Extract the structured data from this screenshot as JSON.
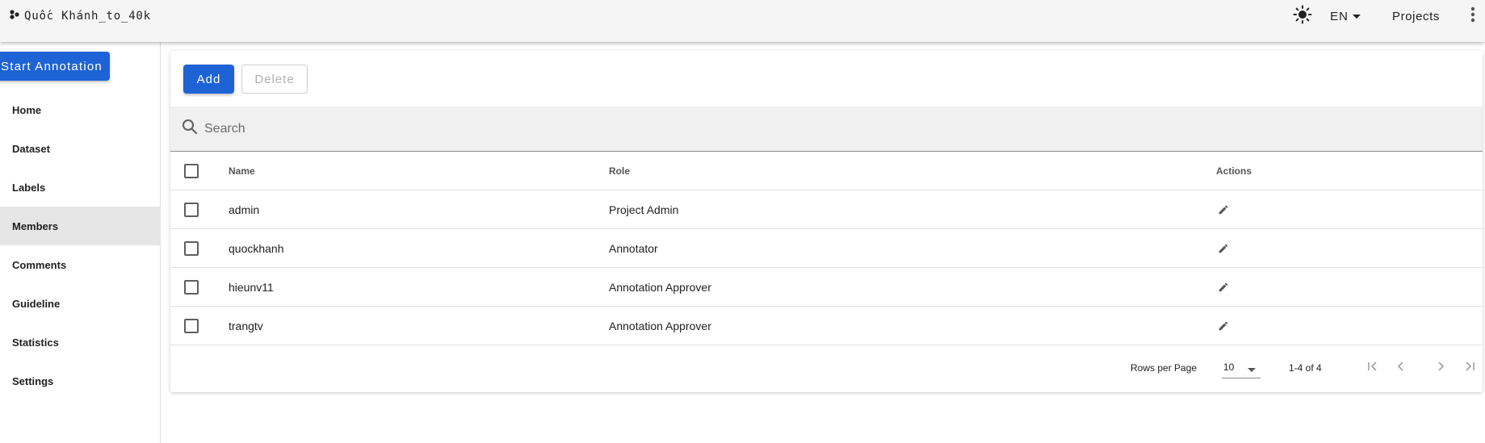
{
  "app": {
    "project_name": "Quốc Khánh_to_40k",
    "language": "EN",
    "projects_label": "Projects",
    "icons": {
      "brand": "hub-icon",
      "theme": "sun-icon",
      "lang_dropdown": "caret-down-icon",
      "more": "more-vert-icon"
    }
  },
  "sidebar": {
    "start_button": "Start Annotation",
    "items": [
      {
        "label": "Home",
        "active": false
      },
      {
        "label": "Dataset",
        "active": false
      },
      {
        "label": "Labels",
        "active": false
      },
      {
        "label": "Members",
        "active": true
      },
      {
        "label": "Comments",
        "active": false
      },
      {
        "label": "Guideline",
        "active": false
      },
      {
        "label": "Statistics",
        "active": false
      },
      {
        "label": "Settings",
        "active": false
      }
    ]
  },
  "toolbar": {
    "add_label": "Add",
    "delete_label": "Delete"
  },
  "search": {
    "placeholder": "Search",
    "value": ""
  },
  "table": {
    "headers": {
      "name": "Name",
      "role": "Role",
      "actions": "Actions"
    },
    "rows": [
      {
        "name": "admin",
        "role": "Project Admin"
      },
      {
        "name": "quockhanh",
        "role": "Annotator"
      },
      {
        "name": "hieunv11",
        "role": "Annotation Approver"
      },
      {
        "name": "trangtv",
        "role": "Annotation Approver"
      }
    ]
  },
  "pagination": {
    "rows_per_page_label": "Rows per Page",
    "rows_per_page": "10",
    "range": "1-4 of 4"
  },
  "colors": {
    "primary": "#1e63d6",
    "appbar": "#f5f5f5",
    "active_nav": "#e6e6e6",
    "search_bg": "#f0f0f0"
  }
}
